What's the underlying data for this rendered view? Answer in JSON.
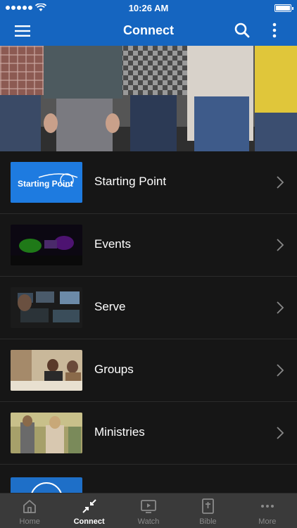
{
  "status_bar": {
    "time": "10:26 AM"
  },
  "header": {
    "title": "Connect"
  },
  "list": [
    {
      "label": "Starting Point",
      "thumb_text": "Starting Point",
      "icon": "starting-point-logo"
    },
    {
      "label": "Events",
      "icon": "events-photo"
    },
    {
      "label": "Serve",
      "icon": "serve-photo"
    },
    {
      "label": "Groups",
      "icon": "groups-photo"
    },
    {
      "label": "Ministries",
      "icon": "ministries-photo"
    }
  ],
  "tabs": [
    {
      "label": "Home",
      "icon": "home-icon",
      "active": false
    },
    {
      "label": "Connect",
      "icon": "connect-icon",
      "active": true
    },
    {
      "label": "Watch",
      "icon": "watch-icon",
      "active": false
    },
    {
      "label": "Bible",
      "icon": "bible-icon",
      "active": false
    },
    {
      "label": "More",
      "icon": "more-icon",
      "active": false
    }
  ],
  "colors": {
    "accent": "#1565c0",
    "background": "#161616",
    "tabbar": "#3a3a3a"
  }
}
